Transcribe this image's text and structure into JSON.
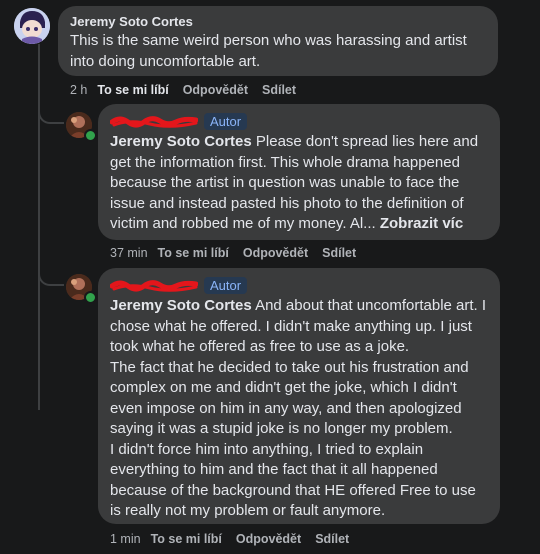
{
  "comment1": {
    "author": "Jeremy Soto Cortes",
    "text": "This is the same weird person who was harassing and artist into doing uncomfortable art.",
    "time": "2 h",
    "like": "To se mi líbí",
    "reply": "Odpovědět",
    "share": "Sdílet"
  },
  "reply1": {
    "badge": "Autor",
    "author": "Jeremy Soto Cortes",
    "text": "Please don't spread lies here and get the information first. This whole drama happened because the artist in question was unable to face the issue and instead pasted his photo to the definition of victim and robbed me of my money. Al...",
    "see_more": "Zobrazit víc",
    "time": "37 min",
    "like": "To se mi líbí",
    "reply": "Odpovědět",
    "share": "Sdílet"
  },
  "reply2": {
    "badge": "Autor",
    "author": "Jeremy Soto Cortes",
    "text": "And about that uncomfortable art. I chose what he offered. I didn't make anything up. I just took what he offered as free to use as a joke.",
    "text2": "The fact that he decided to take out his frustration and complex on me and didn't get the joke, which I didn't even impose on him in any way, and then apologized saying it was a stupid joke is no longer my problem.",
    "text3": "I didn't force him into anything, I tried to explain everything to him and the fact that it all happened because of the background that HE offered Free to use is really not my problem or fault anymore.",
    "time": "1 min",
    "like": "To se mi líbí",
    "reply": "Odpovědět",
    "share": "Sdílet"
  },
  "colors": {
    "background": "#18191a",
    "bubble": "#3a3b3c",
    "badge_bg": "#263951",
    "badge_text": "#8ab4f8",
    "scribble": "#e4161b",
    "online": "#31a24c"
  }
}
